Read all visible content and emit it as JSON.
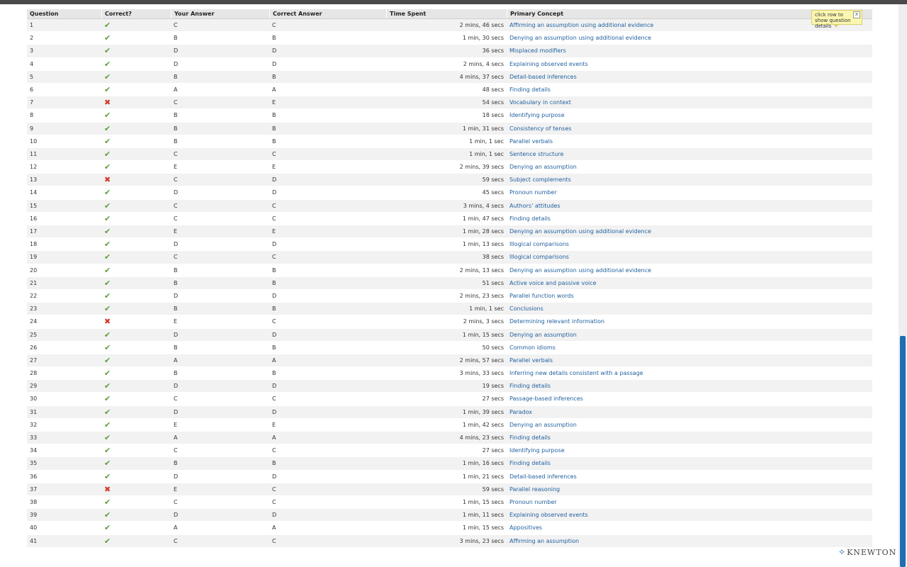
{
  "table": {
    "headers": {
      "question": "Question",
      "correct": "Correct?",
      "your_answer": "Your Answer",
      "correct_answer": "Correct Answer",
      "time_spent": "Time Spent",
      "primary_concept": "Primary Concept"
    },
    "icons": {
      "correct": "checkmark-icon",
      "incorrect": "cross-icon"
    },
    "rows": [
      {
        "q": "1",
        "correct": true,
        "your": "C",
        "answer": "C",
        "time": "2 mins, 46 secs",
        "concept": "Affirming an assumption using additional evidence"
      },
      {
        "q": "2",
        "correct": true,
        "your": "B",
        "answer": "B",
        "time": "1 min, 30 secs",
        "concept": "Denying an assumption using additional evidence"
      },
      {
        "q": "3",
        "correct": true,
        "your": "D",
        "answer": "D",
        "time": "36 secs",
        "concept": "Misplaced modifiers"
      },
      {
        "q": "4",
        "correct": true,
        "your": "D",
        "answer": "D",
        "time": "2 mins, 4 secs",
        "concept": "Explaining observed events"
      },
      {
        "q": "5",
        "correct": true,
        "your": "B",
        "answer": "B",
        "time": "4 mins, 37 secs",
        "concept": "Detail-based inferences"
      },
      {
        "q": "6",
        "correct": true,
        "your": "A",
        "answer": "A",
        "time": "48 secs",
        "concept": "Finding details"
      },
      {
        "q": "7",
        "correct": false,
        "your": "C",
        "answer": "E",
        "time": "54 secs",
        "concept": "Vocabulary in context"
      },
      {
        "q": "8",
        "correct": true,
        "your": "B",
        "answer": "B",
        "time": "18 secs",
        "concept": "Identifying purpose"
      },
      {
        "q": "9",
        "correct": true,
        "your": "B",
        "answer": "B",
        "time": "1 min, 31 secs",
        "concept": "Consistency of tenses"
      },
      {
        "q": "10",
        "correct": true,
        "your": "B",
        "answer": "B",
        "time": "1 min, 1 sec",
        "concept": "Parallel verbals"
      },
      {
        "q": "11",
        "correct": true,
        "your": "C",
        "answer": "C",
        "time": "1 min, 1 sec",
        "concept": "Sentence structure"
      },
      {
        "q": "12",
        "correct": true,
        "your": "E",
        "answer": "E",
        "time": "2 mins, 39 secs",
        "concept": "Denying an assumption"
      },
      {
        "q": "13",
        "correct": false,
        "your": "C",
        "answer": "D",
        "time": "59 secs",
        "concept": "Subject complements"
      },
      {
        "q": "14",
        "correct": true,
        "your": "D",
        "answer": "D",
        "time": "45 secs",
        "concept": "Pronoun number"
      },
      {
        "q": "15",
        "correct": true,
        "your": "C",
        "answer": "C",
        "time": "3 mins, 4 secs",
        "concept": "Authors' attitudes"
      },
      {
        "q": "16",
        "correct": true,
        "your": "C",
        "answer": "C",
        "time": "1 min, 47 secs",
        "concept": "Finding details"
      },
      {
        "q": "17",
        "correct": true,
        "your": "E",
        "answer": "E",
        "time": "1 min, 28 secs",
        "concept": "Denying an assumption using additional evidence"
      },
      {
        "q": "18",
        "correct": true,
        "your": "D",
        "answer": "D",
        "time": "1 min, 13 secs",
        "concept": "Illogical comparisons"
      },
      {
        "q": "19",
        "correct": true,
        "your": "C",
        "answer": "C",
        "time": "38 secs",
        "concept": "Illogical comparisons"
      },
      {
        "q": "20",
        "correct": true,
        "your": "B",
        "answer": "B",
        "time": "2 mins, 13 secs",
        "concept": "Denying an assumption using additional evidence"
      },
      {
        "q": "21",
        "correct": true,
        "your": "B",
        "answer": "B",
        "time": "51 secs",
        "concept": "Active voice and passive voice"
      },
      {
        "q": "22",
        "correct": true,
        "your": "D",
        "answer": "D",
        "time": "2 mins, 23 secs",
        "concept": "Parallel function words"
      },
      {
        "q": "23",
        "correct": true,
        "your": "B",
        "answer": "B",
        "time": "1 min, 1 sec",
        "concept": "Conclusions"
      },
      {
        "q": "24",
        "correct": false,
        "your": "E",
        "answer": "C",
        "time": "2 mins, 3 secs",
        "concept": "Determining relevant information"
      },
      {
        "q": "25",
        "correct": true,
        "your": "D",
        "answer": "D",
        "time": "1 min, 15 secs",
        "concept": "Denying an assumption"
      },
      {
        "q": "26",
        "correct": true,
        "your": "B",
        "answer": "B",
        "time": "50 secs",
        "concept": "Common idioms"
      },
      {
        "q": "27",
        "correct": true,
        "your": "A",
        "answer": "A",
        "time": "2 mins, 57 secs",
        "concept": "Parallel verbals"
      },
      {
        "q": "28",
        "correct": true,
        "your": "B",
        "answer": "B",
        "time": "3 mins, 33 secs",
        "concept": "Inferring new details consistent with a passage"
      },
      {
        "q": "29",
        "correct": true,
        "your": "D",
        "answer": "D",
        "time": "19 secs",
        "concept": "Finding details"
      },
      {
        "q": "30",
        "correct": true,
        "your": "C",
        "answer": "C",
        "time": "27 secs",
        "concept": "Passage-based inferences"
      },
      {
        "q": "31",
        "correct": true,
        "your": "D",
        "answer": "D",
        "time": "1 min, 39 secs",
        "concept": "Paradox"
      },
      {
        "q": "32",
        "correct": true,
        "your": "E",
        "answer": "E",
        "time": "1 min, 42 secs",
        "concept": "Denying an assumption"
      },
      {
        "q": "33",
        "correct": true,
        "your": "A",
        "answer": "A",
        "time": "4 mins, 23 secs",
        "concept": "Finding details"
      },
      {
        "q": "34",
        "correct": true,
        "your": "C",
        "answer": "C",
        "time": "27 secs",
        "concept": "Identifying purpose"
      },
      {
        "q": "35",
        "correct": true,
        "your": "B",
        "answer": "B",
        "time": "1 min, 16 secs",
        "concept": "Finding details"
      },
      {
        "q": "36",
        "correct": true,
        "your": "D",
        "answer": "D",
        "time": "1 min, 21 secs",
        "concept": "Detail-based inferences"
      },
      {
        "q": "37",
        "correct": false,
        "your": "E",
        "answer": "C",
        "time": "59 secs",
        "concept": "Parallel reasoning"
      },
      {
        "q": "38",
        "correct": true,
        "your": "C",
        "answer": "C",
        "time": "1 min, 15 secs",
        "concept": "Pronoun number"
      },
      {
        "q": "39",
        "correct": true,
        "your": "D",
        "answer": "D",
        "time": "1 min, 11 secs",
        "concept": "Explaining observed events"
      },
      {
        "q": "40",
        "correct": true,
        "your": "A",
        "answer": "A",
        "time": "1 min, 15 secs",
        "concept": "Appositives"
      },
      {
        "q": "41",
        "correct": true,
        "your": "C",
        "answer": "C",
        "time": "3 mins, 23 secs",
        "concept": "Affirming an assumption"
      }
    ]
  },
  "tooltip": {
    "text": "click row to show question details",
    "close_label": "x"
  },
  "brand": {
    "name": "KNEWTON",
    "icon": "knewton-logo-icon"
  },
  "colors": {
    "link": "#1f5f9e",
    "correct": "#5b9e3e",
    "incorrect": "#d33a2a",
    "tooltip_bg": "#fbf7b0"
  }
}
